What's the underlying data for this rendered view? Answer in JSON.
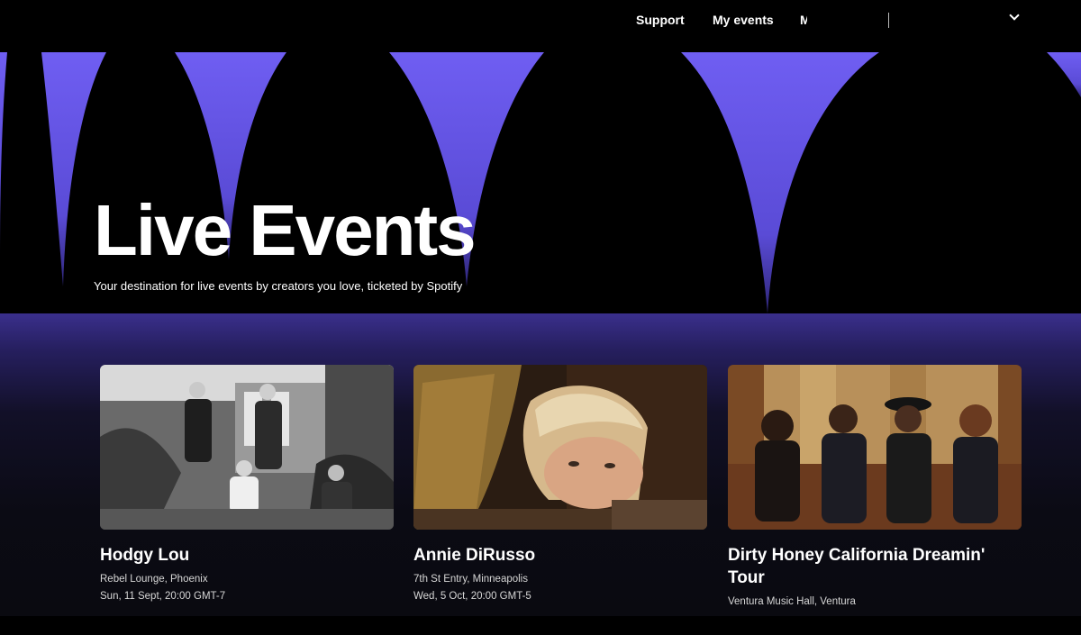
{
  "nav": {
    "support": "Support",
    "my_events": "My events",
    "more": "M"
  },
  "hero": {
    "title": "Live Events",
    "subtitle": "Your destination for live events by creators you love, ticketed by Spotify",
    "accent_color": "#6f5ef2"
  },
  "events": [
    {
      "name": "Hodgy Lou",
      "venue": "Rebel Lounge, Phoenix",
      "datetime": "Sun, 11 Sept, 20:00 GMT-7"
    },
    {
      "name": "Annie DiRusso",
      "venue": "7th St Entry, Minneapolis",
      "datetime": "Wed, 5 Oct, 20:00 GMT-5"
    },
    {
      "name": "Dirty Honey California Dreamin' Tour",
      "venue": "Ventura Music Hall, Ventura",
      "datetime": ""
    }
  ]
}
